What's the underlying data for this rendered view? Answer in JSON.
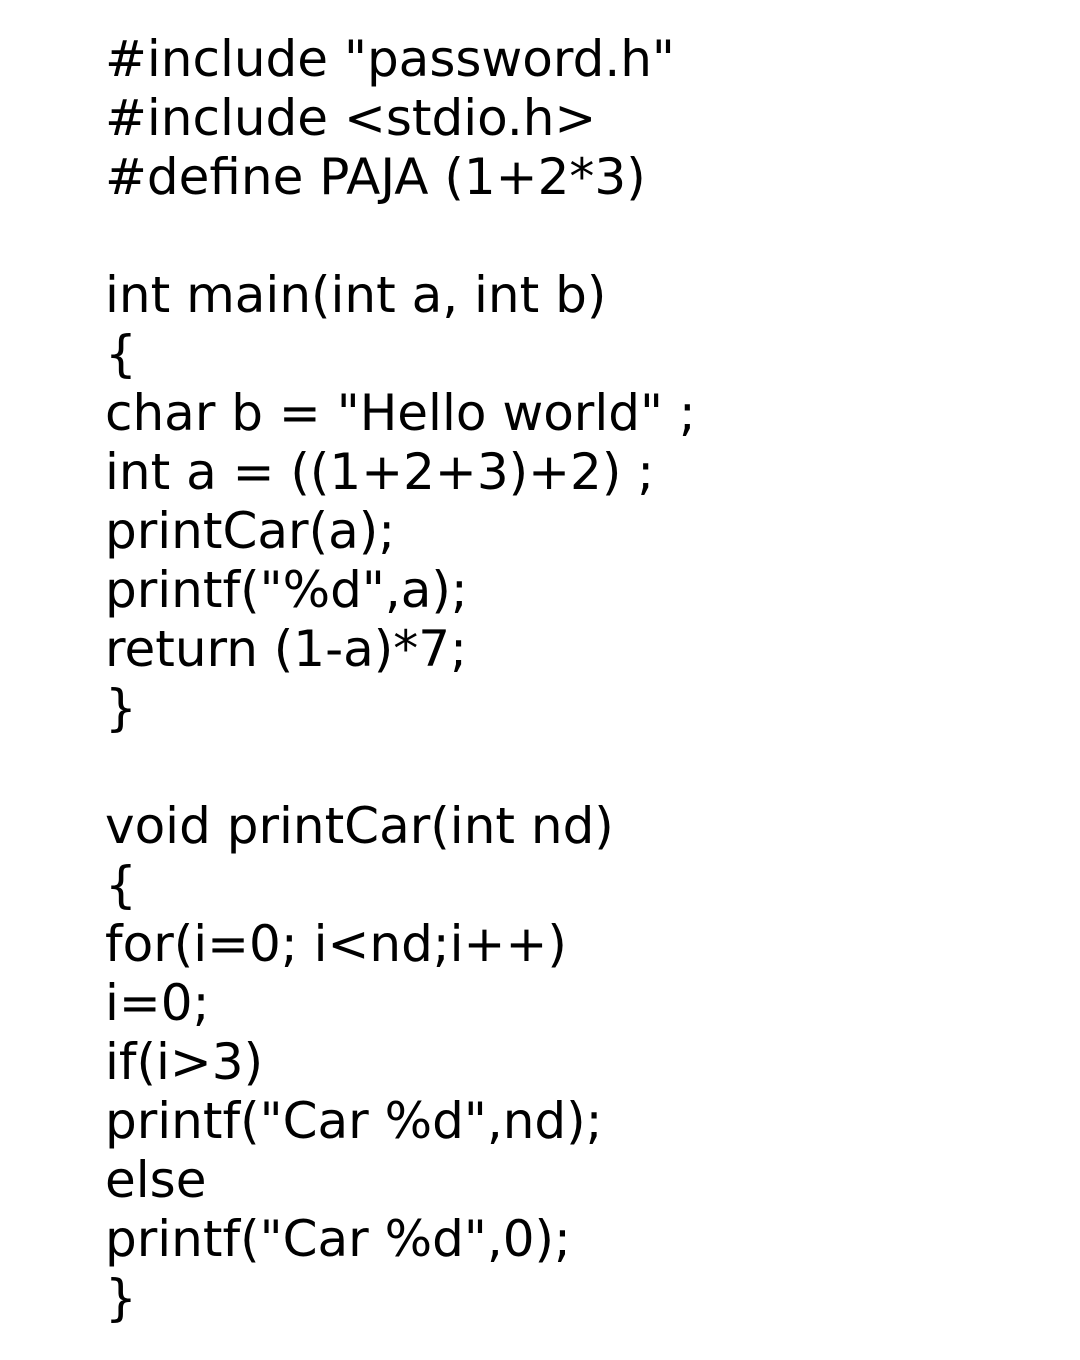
{
  "code": {
    "lines": [
      "#include \"password.h\"",
      "#include <stdio.h>",
      "#define PAJA (1+2*3)",
      "",
      "int main(int a, int b)",
      "{",
      "char b = \"Hello world\" ;",
      "int a = ((1+2+3)+2) ;",
      "printCar(a);",
      "printf(\"%d\",a);",
      "return (1-a)*7;",
      "}",
      "",
      "void printCar(int nd)",
      "{",
      "for(i=0; i<nd;i++)",
      "i=0;",
      "if(i>3)",
      "printf(\"Car %d\",nd);",
      "else",
      "printf(\"Car %d\",0);",
      "}"
    ]
  }
}
